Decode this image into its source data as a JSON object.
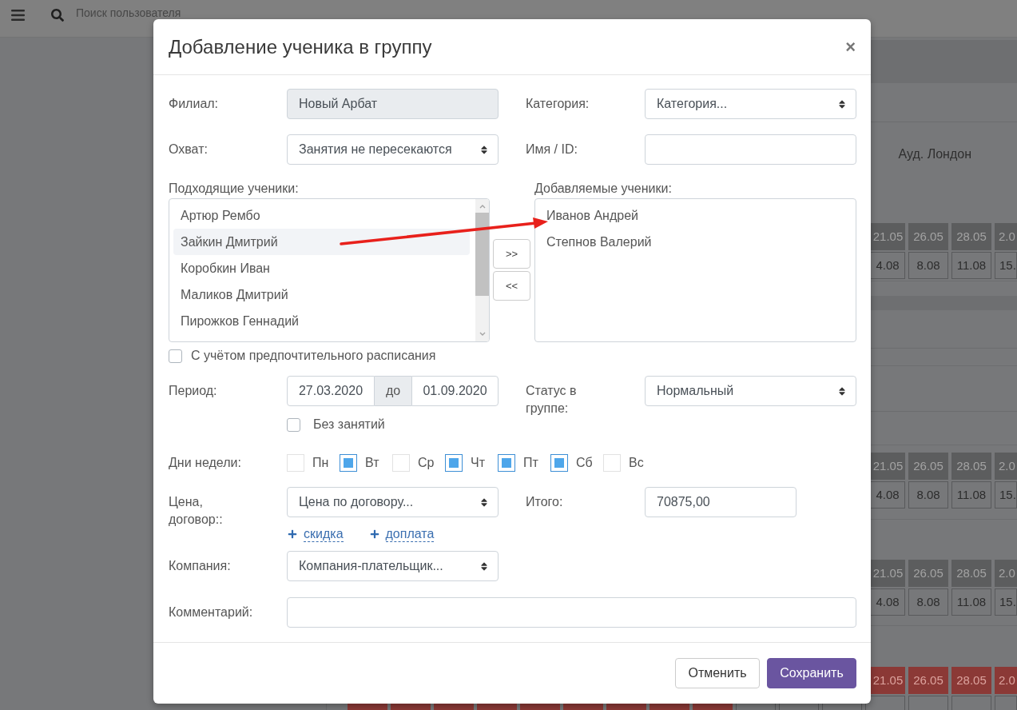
{
  "header": {
    "search": {
      "placeholder": "Поиск пользователя"
    }
  },
  "schedule": {
    "room": "Ауд. Лондон",
    "blocks": [
      {
        "rows": [
          {
            "kind": "dark",
            "cells": [
              "21.05",
              "26.05",
              "28.05",
              "2.0"
            ]
          },
          {
            "kind": "light",
            "cells": [
              "4.08",
              "8.08",
              "11.08",
              "15."
            ]
          }
        ]
      },
      {
        "rows": [
          {
            "kind": "dark",
            "cells": [
              "21.05",
              "26.05",
              "28.05",
              "2.0"
            ]
          },
          {
            "kind": "light",
            "cells": [
              "4.08",
              "8.08",
              "11.08",
              "15."
            ]
          }
        ]
      },
      {
        "rows": [
          {
            "kind": "dark",
            "cells": [
              "21.05",
              "26.05",
              "28.05",
              "2.0"
            ]
          },
          {
            "kind": "light",
            "cells": [
              "4.08",
              "8.08",
              "11.08",
              "15."
            ]
          }
        ]
      },
      {
        "rows": [
          {
            "kind": "red",
            "cells": [
              "21.05",
              "26.05",
              "28.05",
              "2.0"
            ]
          }
        ]
      }
    ],
    "last_row": [
      {
        "kind": "red"
      },
      {
        "kind": "red"
      },
      {
        "kind": "red"
      },
      {
        "kind": "red"
      },
      {
        "kind": "red"
      },
      {
        "kind": "red"
      },
      {
        "kind": "red"
      },
      {
        "kind": "red"
      },
      {
        "kind": "red"
      },
      {
        "kind": "light"
      },
      {
        "kind": "light"
      },
      {
        "kind": "light"
      },
      {
        "kind": "light"
      },
      {
        "kind": "light"
      },
      {
        "kind": "light"
      },
      {
        "kind": "light"
      }
    ]
  },
  "dialog": {
    "title": "Добавление ученика в группу",
    "close": "×",
    "branch": {
      "label": "Филиал:",
      "value": "Новый Арбат",
      "disabled": true
    },
    "category": {
      "label": "Категория:",
      "value": "Категория..."
    },
    "scope": {
      "label": "Охват:",
      "value": "Занятия не пересекаются"
    },
    "name_id": {
      "label": "Имя / ID:"
    },
    "suitable_students": {
      "label": "Подходящие ученики:",
      "items": [
        {
          "name": "Артюр Рембо",
          "selected": false
        },
        {
          "name": "Зайкин Дмитрий",
          "selected": true
        },
        {
          "name": "Коробкин Иван",
          "selected": false
        },
        {
          "name": "Маликов Дмитрий",
          "selected": false
        },
        {
          "name": "Пирожков Геннадий",
          "selected": false
        }
      ]
    },
    "move_buttons": [
      ">>",
      "<<"
    ],
    "added_students": {
      "label": "Добавляемые ученики:",
      "items": [
        {
          "name": "Иванов Андрей",
          "selected": false
        },
        {
          "name": "Степнов Валерий",
          "selected": false
        }
      ]
    },
    "preferred_schedule": {
      "label": "С учётом предпочтительного расписания",
      "checked": false
    },
    "period": {
      "label": "Период:",
      "from": "27.03.2020",
      "separator": "до",
      "to": "01.09.2020"
    },
    "no_lessons": {
      "label": "Без занятий",
      "checked": false
    },
    "status": {
      "label": "Статус в группе:",
      "value": "Нормальный"
    },
    "weekdays": {
      "label": "Дни недели:",
      "days": [
        {
          "label": "Пн",
          "checked": false
        },
        {
          "label": "Вт",
          "checked": true
        },
        {
          "label": "Ср",
          "checked": false
        },
        {
          "label": "Чт",
          "checked": true
        },
        {
          "label": "Пт",
          "checked": true
        },
        {
          "label": "Сб",
          "checked": true
        },
        {
          "label": "Вс",
          "checked": false
        }
      ]
    },
    "price": {
      "label": "Цена, договор::",
      "value": "Цена по договору...",
      "links": [
        "скидка",
        "доплата"
      ]
    },
    "total": {
      "label": "Итого:",
      "value": "70875,00"
    },
    "company": {
      "label": "Компания:",
      "value": "Компания-плательщик..."
    },
    "comment": {
      "label": "Комментарий:"
    },
    "buttons": [
      {
        "label": "Отменить",
        "kind": "secondary"
      },
      {
        "label": "Сохранить",
        "kind": "primary"
      }
    ]
  }
}
